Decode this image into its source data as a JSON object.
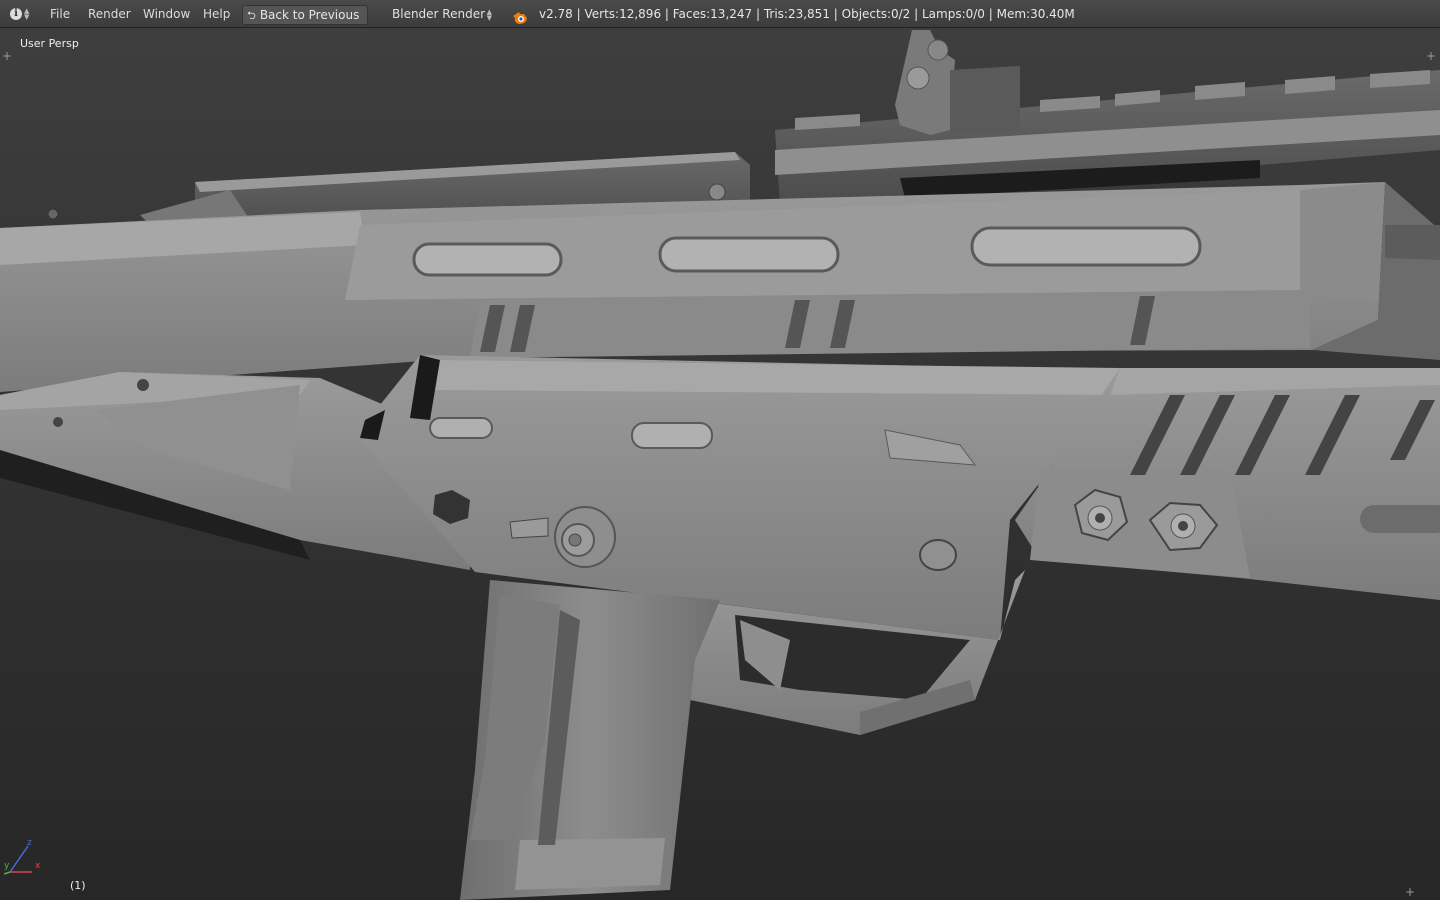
{
  "header": {
    "info_icon": "info-icon",
    "menus": [
      {
        "label": "File"
      },
      {
        "label": "Render"
      },
      {
        "label": "Window"
      },
      {
        "label": "Help"
      }
    ],
    "back_button": {
      "label": "Back to Previous",
      "icon": "back-arrow-icon"
    },
    "render_engine": "Blender Render",
    "logo_icon": "blender-logo-icon",
    "stats": "v2.78 | Verts:12,896 | Faces:13,247 | Tris:23,851 | Objects:0/2 | Lamps:0/0 | Mem:30.40M"
  },
  "viewport": {
    "view_label": "User Persp",
    "frame_label": "(1)",
    "axis_labels": {
      "x": "x",
      "y": "y",
      "z": "z"
    },
    "colors": {
      "x_axis": "#d44a4a",
      "y_axis": "#4ab34a",
      "z_axis": "#4a6ad4",
      "mesh": "#8e8e8e"
    }
  }
}
